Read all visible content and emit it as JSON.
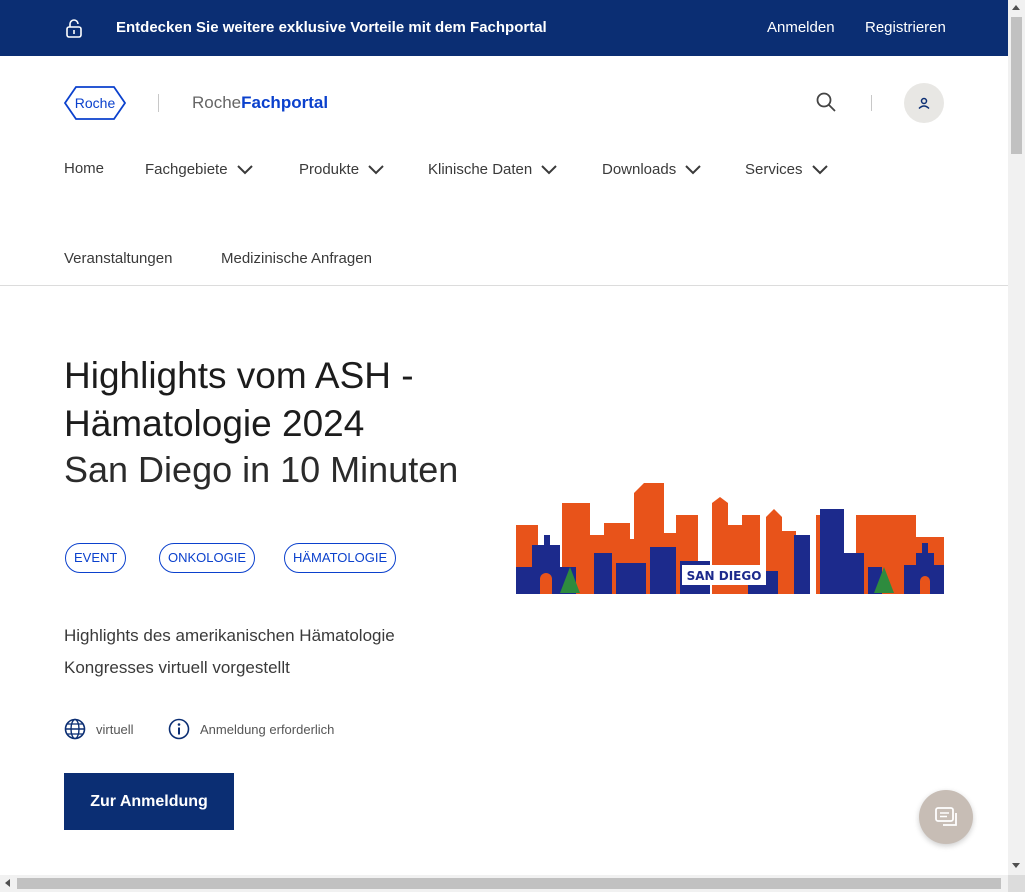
{
  "topbar": {
    "promo_text": "Entdecken Sie weitere exklusive Vorteile mit dem Fachportal",
    "login_label": "Anmelden",
    "register_label": "Registrieren",
    "background_color": "#0b2e73"
  },
  "header": {
    "logo_text": "Roche",
    "brand_prefix": "Roche",
    "brand_name": "Fachportal",
    "brand_color": "#0b41cd"
  },
  "nav": {
    "items": [
      {
        "label": "Home",
        "has_dropdown": false
      },
      {
        "label": "Fachgebiete",
        "has_dropdown": true
      },
      {
        "label": "Produkte",
        "has_dropdown": true
      },
      {
        "label": "Klinische Daten",
        "has_dropdown": true
      },
      {
        "label": "Downloads",
        "has_dropdown": true
      },
      {
        "label": "Services",
        "has_dropdown": true
      },
      {
        "label": "Veranstaltungen",
        "has_dropdown": false
      },
      {
        "label": "Medizinische Anfragen",
        "has_dropdown": false
      }
    ]
  },
  "hero": {
    "title": "Highlights vom ASH - Hämatologie 2024",
    "subtitle": "San Diego in 10 Minuten",
    "tags": [
      "EVENT",
      "ONKOLOGIE",
      "HÄMATOLOGIE"
    ],
    "description": "Highlights des amerikanischen Hämatologie Kongresses virtuell vorgestellt",
    "meta": [
      {
        "icon": "globe-icon",
        "label": "virtuell"
      },
      {
        "icon": "info-icon",
        "label": "Anmeldung erforderlich"
      }
    ],
    "cta_label": "Zur Anmeldung",
    "image_caption": "SAN DIEGO"
  }
}
